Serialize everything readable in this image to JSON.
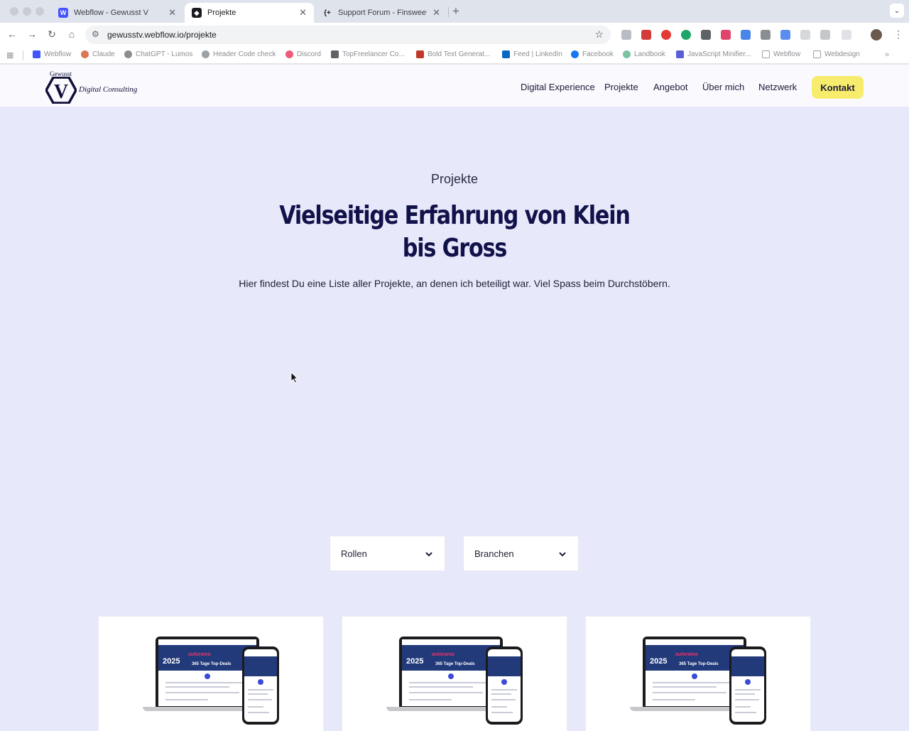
{
  "browser": {
    "tabs": [
      {
        "title": "Webflow - Gewusst V",
        "favicon": "webflow-icon",
        "active": false
      },
      {
        "title": "Projekte",
        "favicon": "webflow-cube-icon",
        "active": true
      },
      {
        "title": "Support Forum - Finsweet Su",
        "favicon": "finsweet-icon",
        "active": false
      }
    ],
    "url": "gewusstv.webflow.io/projekte",
    "bookmarks": [
      "Webflow",
      "Claude",
      "ChatGPT - Lumos",
      "Header Code check",
      "Discord",
      "TopFreelancer Co...",
      "Bold Text Generat...",
      "Feed | LinkedIn",
      "Facebook",
      "Landbook",
      "JavaScript Minifier...",
      "Webflow",
      "Webdesign"
    ]
  },
  "site": {
    "logo": {
      "top": "Gewusst",
      "letter": "V",
      "sub": "Digital Consulting"
    },
    "nav": [
      "Digital Experience",
      "Projekte",
      "Angebot",
      "Über mich",
      "Netzwerk"
    ],
    "cta": "Kontakt",
    "eyebrow": "Projekte",
    "headline_line1": "Vielseitige Erfahrung von Klein",
    "headline_line2": "bis Gross",
    "lede": "Hier findest Du eine Liste aller Projekte, an denen ich beteiligt war. Viel Spass beim Durchstöbern.",
    "filters": [
      "Rollen",
      "Branchen"
    ],
    "card_mock": {
      "year": "2025",
      "pill": "365 Tage Top-Deals",
      "brand": "autorama"
    }
  },
  "colors": {
    "page_bg": "#e8e8fb",
    "header_bg": "#f9f9fe",
    "headline": "#12124a",
    "cta_bg": "#f7ec6b"
  }
}
